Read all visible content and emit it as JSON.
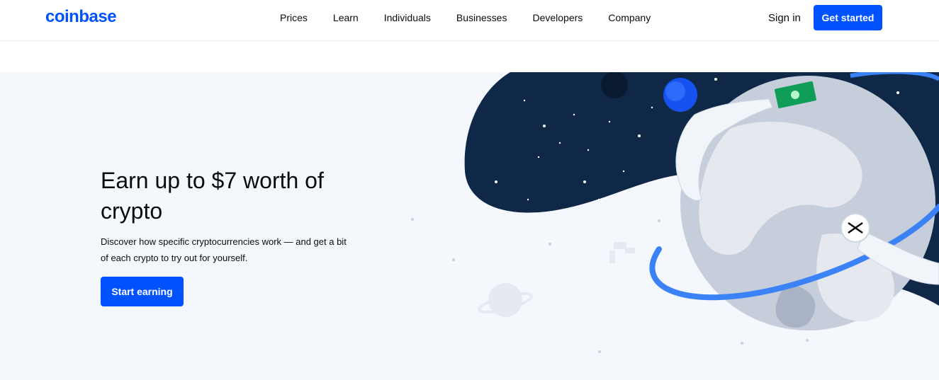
{
  "header": {
    "logo": "coinbase",
    "nav": [
      "Prices",
      "Learn",
      "Individuals",
      "Businesses",
      "Developers",
      "Company"
    ],
    "sign_in": "Sign in",
    "get_started": "Get started"
  },
  "hero": {
    "title": "Earn up to $7 worth of crypto",
    "description": "Discover how specific cryptocurrencies work — and get a bit of each crypto to try out for yourself.",
    "cta": "Start earning"
  },
  "colors": {
    "brand": "#0052ff",
    "hero_bg": "#f4f7fc",
    "space": "#0f2847"
  },
  "illustration": {
    "name": "astronaut-globe-illustration"
  }
}
